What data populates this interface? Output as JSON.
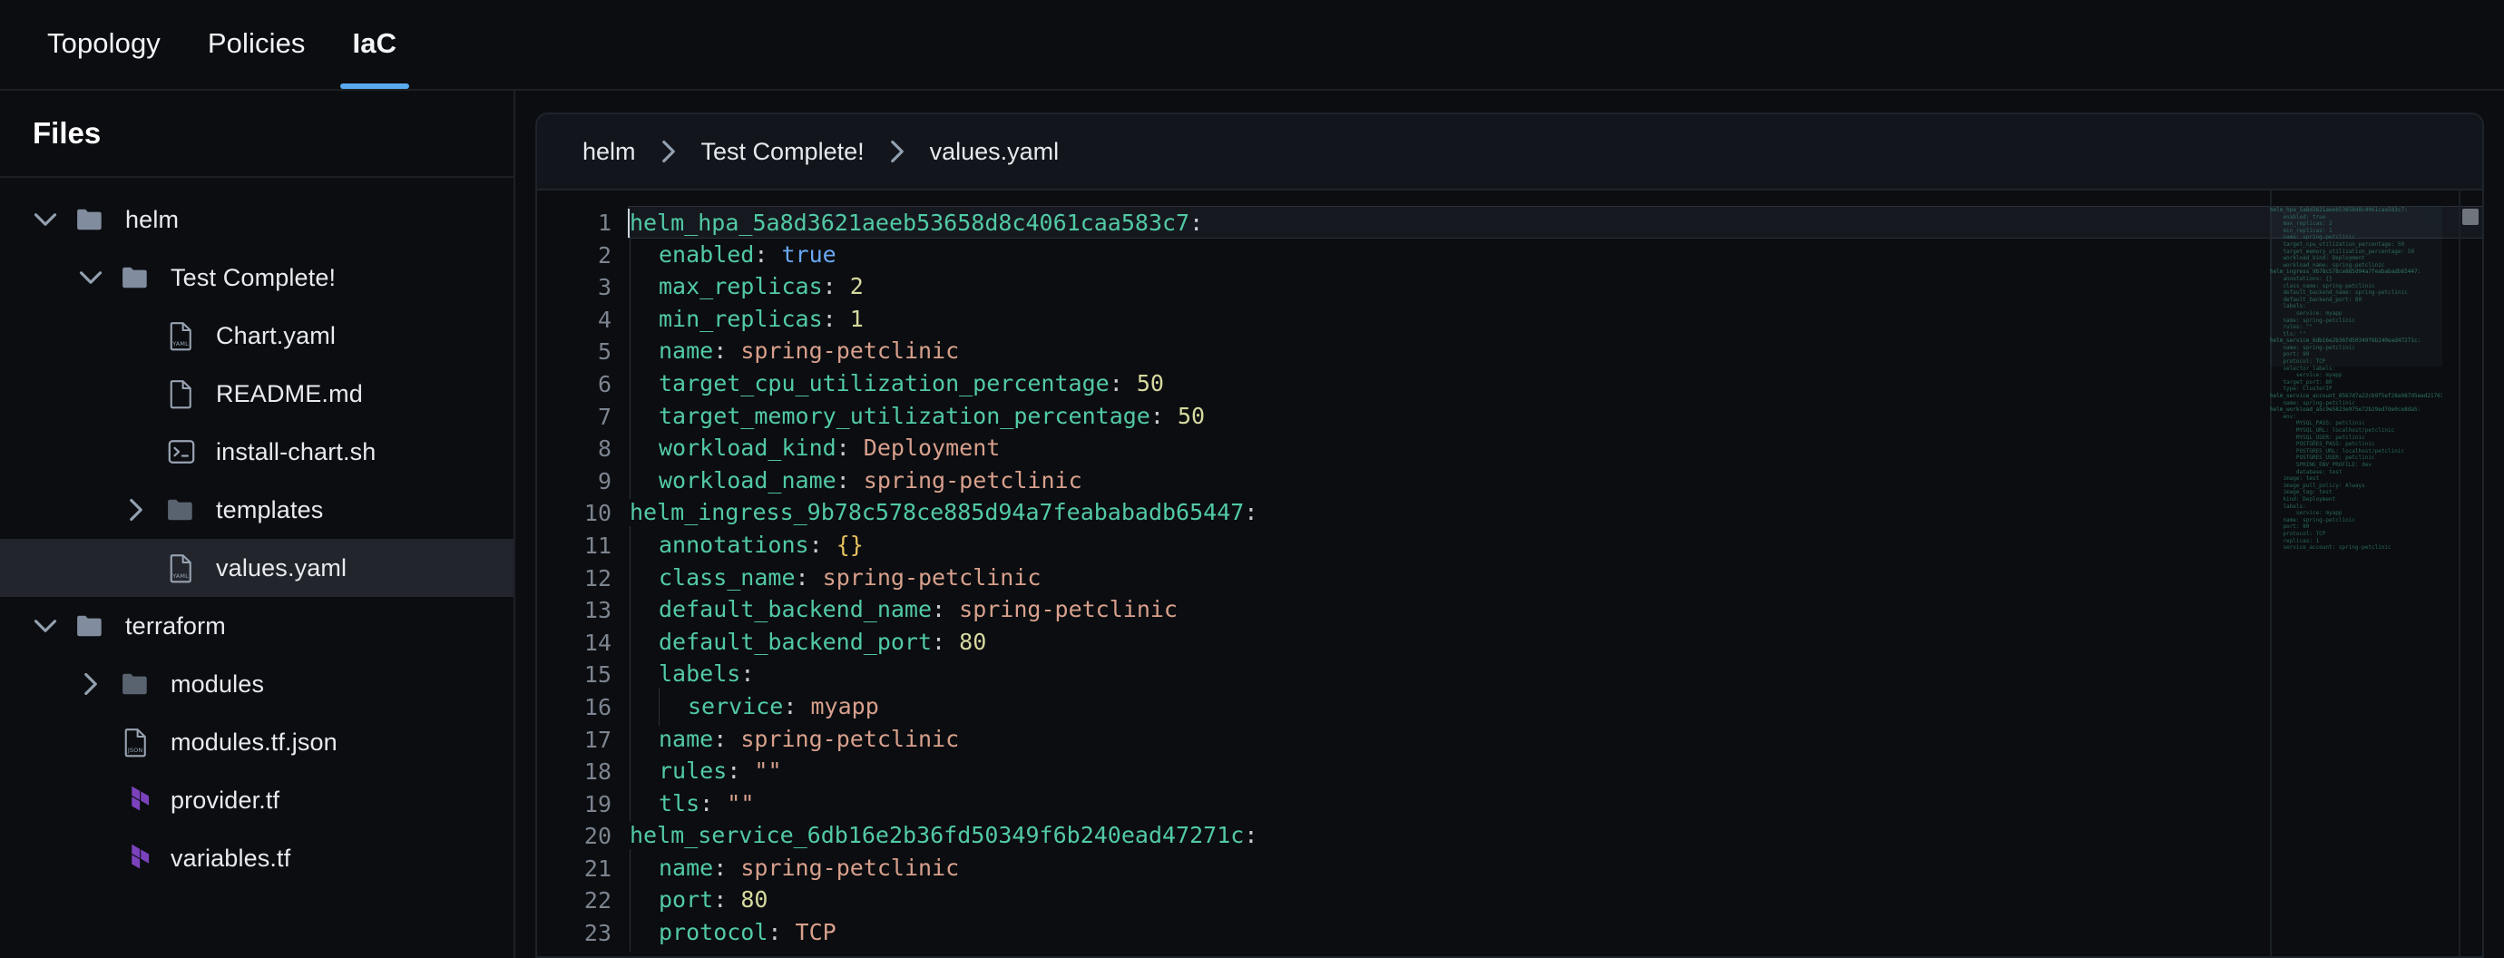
{
  "tabs": [
    {
      "label": "Topology",
      "active": false
    },
    {
      "label": "Policies",
      "active": false
    },
    {
      "label": "IaC",
      "active": true
    }
  ],
  "accent_color": "#5aa9ef",
  "sidebar": {
    "title": "Files",
    "items": [
      {
        "label": "helm",
        "type": "folder",
        "state": "open",
        "depth": 0,
        "icon": "folder-open-icon",
        "selected": false
      },
      {
        "label": "Test Complete!",
        "type": "folder",
        "state": "open",
        "depth": 1,
        "icon": "folder-open-icon",
        "selected": false
      },
      {
        "label": "Chart.yaml",
        "type": "file",
        "state": "none",
        "depth": 2,
        "icon": "yaml-file-icon",
        "selected": false
      },
      {
        "label": "README.md",
        "type": "file",
        "state": "none",
        "depth": 2,
        "icon": "document-file-icon",
        "selected": false
      },
      {
        "label": "install-chart.sh",
        "type": "file",
        "state": "none",
        "depth": 2,
        "icon": "shell-file-icon",
        "selected": false
      },
      {
        "label": "templates",
        "type": "folder",
        "state": "collapsed",
        "depth": 2,
        "icon": "folder-closed-icon",
        "selected": false
      },
      {
        "label": "values.yaml",
        "type": "file",
        "state": "none",
        "depth": 2,
        "icon": "yaml-file-icon",
        "selected": true
      },
      {
        "label": "terraform",
        "type": "folder",
        "state": "open",
        "depth": 0,
        "icon": "folder-open-icon",
        "selected": false
      },
      {
        "label": "modules",
        "type": "folder",
        "state": "collapsed",
        "depth": 1,
        "icon": "folder-closed-icon",
        "selected": false
      },
      {
        "label": "modules.tf.json",
        "type": "file",
        "state": "none",
        "depth": 1,
        "icon": "json-file-icon",
        "selected": false
      },
      {
        "label": "provider.tf",
        "type": "file",
        "state": "none",
        "depth": 1,
        "icon": "terraform-icon",
        "selected": false
      },
      {
        "label": "variables.tf",
        "type": "file",
        "state": "none",
        "depth": 1,
        "icon": "terraform-icon",
        "selected": false
      }
    ]
  },
  "editor": {
    "breadcrumb": [
      "helm",
      "Test Complete!",
      "values.yaml"
    ],
    "breadcrumb_separator_icon": "chevron-right-icon",
    "first_line": 1,
    "last_visible_line": 23,
    "active_line": 1,
    "syntax_colors": {
      "key": "#52c9a8",
      "string": "#d8a08c",
      "number": "#d7d9a0",
      "boolean": "#6ba8f5",
      "brace": "#e5c15f",
      "punctuation": "#c8cdd4",
      "background": "#0b0d10",
      "line_number": "#7c848f"
    },
    "lines": [
      {
        "n": 1,
        "indent": 0,
        "key": "helm_hpa_5a8d3621aeeb53658d8c4061caa583c7",
        "value": "",
        "vtype": "none"
      },
      {
        "n": 2,
        "indent": 1,
        "key": "enabled",
        "value": "true",
        "vtype": "bool"
      },
      {
        "n": 3,
        "indent": 1,
        "key": "max_replicas",
        "value": "2",
        "vtype": "num"
      },
      {
        "n": 4,
        "indent": 1,
        "key": "min_replicas",
        "value": "1",
        "vtype": "num"
      },
      {
        "n": 5,
        "indent": 1,
        "key": "name",
        "value": "spring-petclinic",
        "vtype": "str"
      },
      {
        "n": 6,
        "indent": 1,
        "key": "target_cpu_utilization_percentage",
        "value": "50",
        "vtype": "num"
      },
      {
        "n": 7,
        "indent": 1,
        "key": "target_memory_utilization_percentage",
        "value": "50",
        "vtype": "num"
      },
      {
        "n": 8,
        "indent": 1,
        "key": "workload_kind",
        "value": "Deployment",
        "vtype": "str"
      },
      {
        "n": 9,
        "indent": 1,
        "key": "workload_name",
        "value": "spring-petclinic",
        "vtype": "str"
      },
      {
        "n": 10,
        "indent": 0,
        "key": "helm_ingress_9b78c578ce885d94a7feababadb65447",
        "value": "",
        "vtype": "none"
      },
      {
        "n": 11,
        "indent": 1,
        "key": "annotations",
        "value": "{}",
        "vtype": "brace"
      },
      {
        "n": 12,
        "indent": 1,
        "key": "class_name",
        "value": "spring-petclinic",
        "vtype": "str"
      },
      {
        "n": 13,
        "indent": 1,
        "key": "default_backend_name",
        "value": "spring-petclinic",
        "vtype": "str"
      },
      {
        "n": 14,
        "indent": 1,
        "key": "default_backend_port",
        "value": "80",
        "vtype": "num"
      },
      {
        "n": 15,
        "indent": 1,
        "key": "labels",
        "value": "",
        "vtype": "none"
      },
      {
        "n": 16,
        "indent": 2,
        "key": "service",
        "value": "myapp",
        "vtype": "str"
      },
      {
        "n": 17,
        "indent": 1,
        "key": "name",
        "value": "spring-petclinic",
        "vtype": "str"
      },
      {
        "n": 18,
        "indent": 1,
        "key": "rules",
        "value": "\"\"",
        "vtype": "str"
      },
      {
        "n": 19,
        "indent": 1,
        "key": "tls",
        "value": "\"\"",
        "vtype": "str"
      },
      {
        "n": 20,
        "indent": 0,
        "key": "helm_service_6db16e2b36fd50349f6b240ead47271c",
        "value": "",
        "vtype": "none"
      },
      {
        "n": 21,
        "indent": 1,
        "key": "name",
        "value": "spring-petclinic",
        "vtype": "str"
      },
      {
        "n": 22,
        "indent": 1,
        "key": "port",
        "value": "80",
        "vtype": "num"
      },
      {
        "n": 23,
        "indent": 1,
        "key": "protocol",
        "value": "TCP",
        "vtype": "str"
      }
    ],
    "minimap_lines": [
      "helm_hpa_5a8d3621aeeb53658d8c4061caa583c7:",
      "    enabled: true",
      "    max_replicas: 2",
      "    min_replicas: 1",
      "    name: spring-petclinic",
      "    target_cpu_utilization_percentage: 50",
      "    target_memory_utilization_percentage: 50",
      "    workload_kind: Deployment",
      "    workload_name: spring-petclinic",
      "helm_ingress_9b78c578ce885d94a7feababadb65447:",
      "    annotations: {}",
      "    class_name: spring-petclinic",
      "    default_backend_name: spring-petclinic",
      "    default_backend_port: 80",
      "    labels:",
      "        service: myapp",
      "    name: spring-petclinic",
      "    rules: \"\"",
      "    tls: \"\"",
      "helm_service_6db16e2b36fd50349f6b240ead47271c:",
      "    name: spring-petclinic",
      "    port: 80",
      "    protocol: TCP",
      "    selector_labels:",
      "        service: myapp",
      "    target_port: 80",
      "    type: ClusterIP",
      "helm_service_account_8567d7a22cb9f5ef28a987d5eed217673:",
      "    name: spring-petclinic",
      "helm_workload_a5c9e5823e975e72b29ed7de0ce8da5:",
      "    env:",
      "        MYSQL_PASS: petclinic",
      "        MYSQL_URL: localhost/petclinic",
      "        MYSQL_USER: petclinic",
      "        POSTGRES_PASS: petclinic",
      "        POSTGRES_URL: localhost/petclinic",
      "        POSTGRES_USER: petclinic",
      "        SPRING_ENV_PROFILE: dev",
      "        database: test",
      "    image: test",
      "    image_pull_policy: Always",
      "    image_tag: test",
      "    kind: Deployment",
      "    labels:",
      "        service: myapp",
      "    name: spring-petclinic",
      "    port: 80",
      "    protocol: TCP",
      "    replicas: 1",
      "    service_account: spring-petclinic"
    ]
  }
}
